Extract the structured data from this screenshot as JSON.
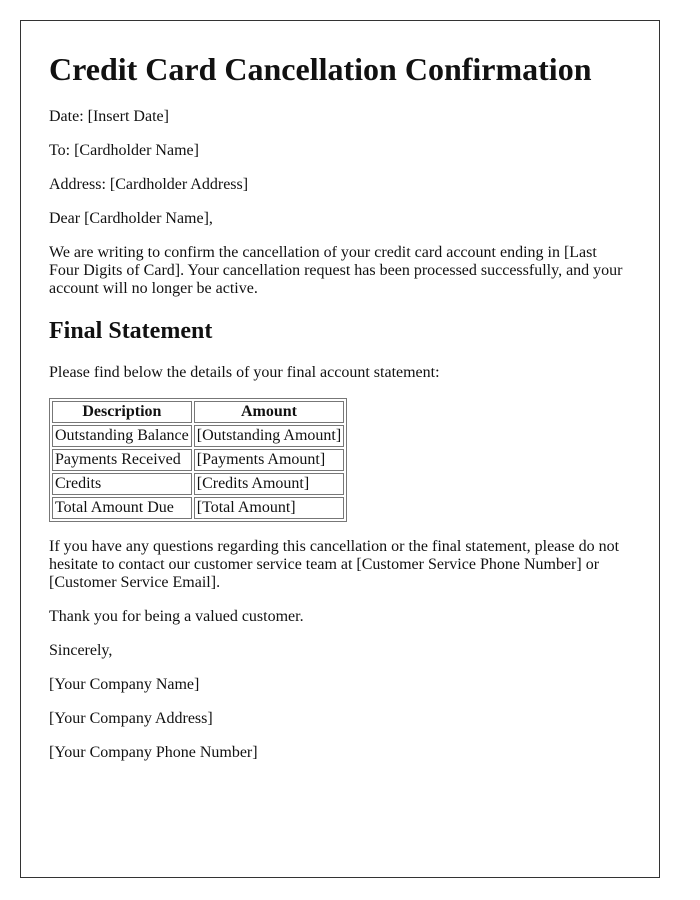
{
  "title": "Credit Card Cancellation Confirmation",
  "header_fields": {
    "date": "Date: [Insert Date]",
    "to": "To: [Cardholder Name]",
    "address": "Address: [Cardholder Address]"
  },
  "salutation": "Dear [Cardholder Name],",
  "intro_paragraph": "We are writing to confirm the cancellation of your credit card account ending in [Last Four Digits of Card]. Your cancellation request has been processed successfully, and your account will no longer be active.",
  "final_statement": {
    "heading": "Final Statement",
    "intro": "Please find below the details of your final account statement:",
    "table": {
      "headers": [
        "Description",
        "Amount"
      ],
      "rows": [
        [
          "Outstanding Balance",
          "[Outstanding Amount]"
        ],
        [
          "Payments Received",
          "[Payments Amount]"
        ],
        [
          "Credits",
          "[Credits Amount]"
        ],
        [
          "Total Amount Due",
          "[Total Amount]"
        ]
      ]
    }
  },
  "contact_paragraph": "If you have any questions regarding this cancellation or the final statement, please do not hesitate to contact our customer service team at [Customer Service Phone Number] or [Customer Service Email].",
  "thanks": "Thank you for being a valued customer.",
  "closing": "Sincerely,",
  "signature": {
    "company_name": "[Your Company Name]",
    "company_address": "[Your Company Address]",
    "company_phone": "[Your Company Phone Number]"
  }
}
